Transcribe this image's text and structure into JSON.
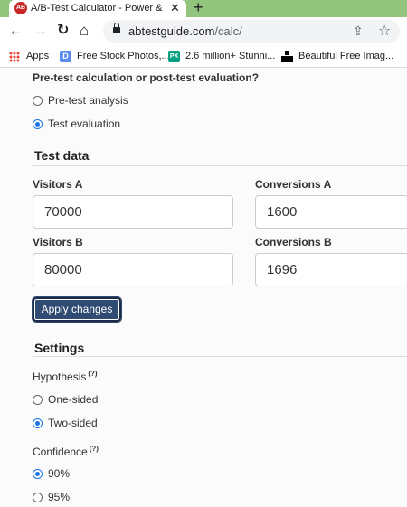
{
  "browser": {
    "tab_title": "A/B-Test Calculator - Power & Si",
    "tab_favicon_text": "AB",
    "url_host": "abtestguide.com",
    "url_path": "/calc/",
    "bookmarks": [
      {
        "label": "Apps",
        "icon": "apps-grid-icon"
      },
      {
        "label": "Free Stock Photos,...",
        "icon_text": "D"
      },
      {
        "label": "2.6 million+ Stunni...",
        "icon_text": "PX"
      },
      {
        "label": "Beautiful Free Imag...",
        "icon": "unsplash-icon"
      }
    ]
  },
  "calc": {
    "type_question": "Pre-test calculation or post-test evaluation?",
    "type_options": [
      {
        "label": "Pre-test analysis",
        "checked": false
      },
      {
        "label": "Test evaluation",
        "checked": true
      }
    ],
    "test_data_title": "Test data",
    "visitors_a_label": "Visitors A",
    "visitors_a_value": "70000",
    "conversions_a_label": "Conversions A",
    "conversions_a_value": "1600",
    "visitors_b_label": "Visitors B",
    "visitors_b_value": "80000",
    "conversions_b_label": "Conversions B",
    "conversions_b_value": "1696",
    "apply_label": "Apply changes",
    "settings_title": "Settings",
    "hypothesis_label": "Hypothesis",
    "hypothesis_help": "(?)",
    "hypothesis_options": [
      {
        "label": "One-sided",
        "checked": false
      },
      {
        "label": "Two-sided",
        "checked": true
      }
    ],
    "confidence_label": "Confidence",
    "confidence_help": "(?)",
    "confidence_options": [
      {
        "label": "90%",
        "checked": true
      },
      {
        "label": "95%",
        "checked": false
      }
    ]
  }
}
